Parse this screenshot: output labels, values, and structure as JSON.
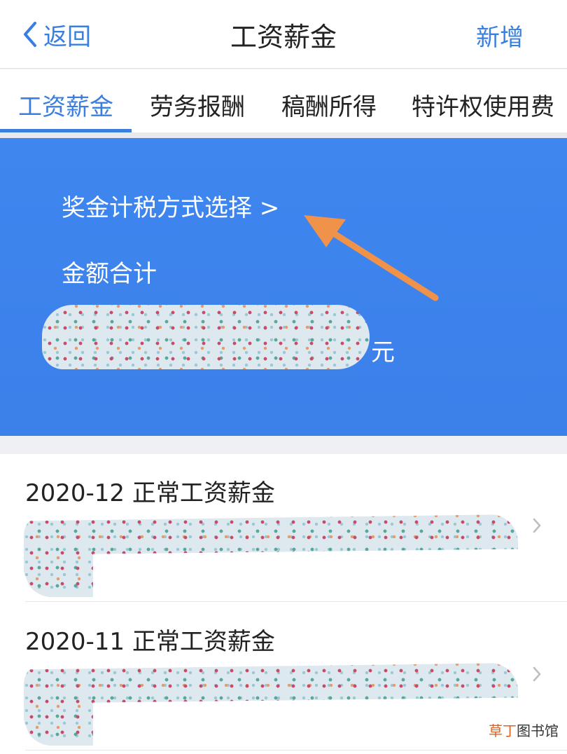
{
  "header": {
    "back_label": "返回",
    "title": "工资薪金",
    "add_label": "新增"
  },
  "tabs": [
    {
      "label": "工资薪金",
      "active": true
    },
    {
      "label": "劳务报酬",
      "active": false
    },
    {
      "label": "稿酬所得",
      "active": false
    },
    {
      "label": "特许权使用费",
      "active": false
    }
  ],
  "summary": {
    "bonus_method_label": "奖金计税方式选择 >",
    "total_label": "金额合计",
    "currency": "元"
  },
  "records": [
    {
      "title": "2020-12 正常工资薪金"
    },
    {
      "title": "2020-11 正常工资薪金"
    }
  ],
  "watermark": {
    "accent": "草丁",
    "rest": "图书馆"
  },
  "colors": {
    "accent_blue": "#3a7fe0",
    "summary_bg": "#3f86ef",
    "annotation_arrow": "#f0924a"
  },
  "icons": {
    "back": "chevron-left-icon",
    "row": "chevron-right-icon",
    "annotation": "arrow-annotation-icon"
  }
}
